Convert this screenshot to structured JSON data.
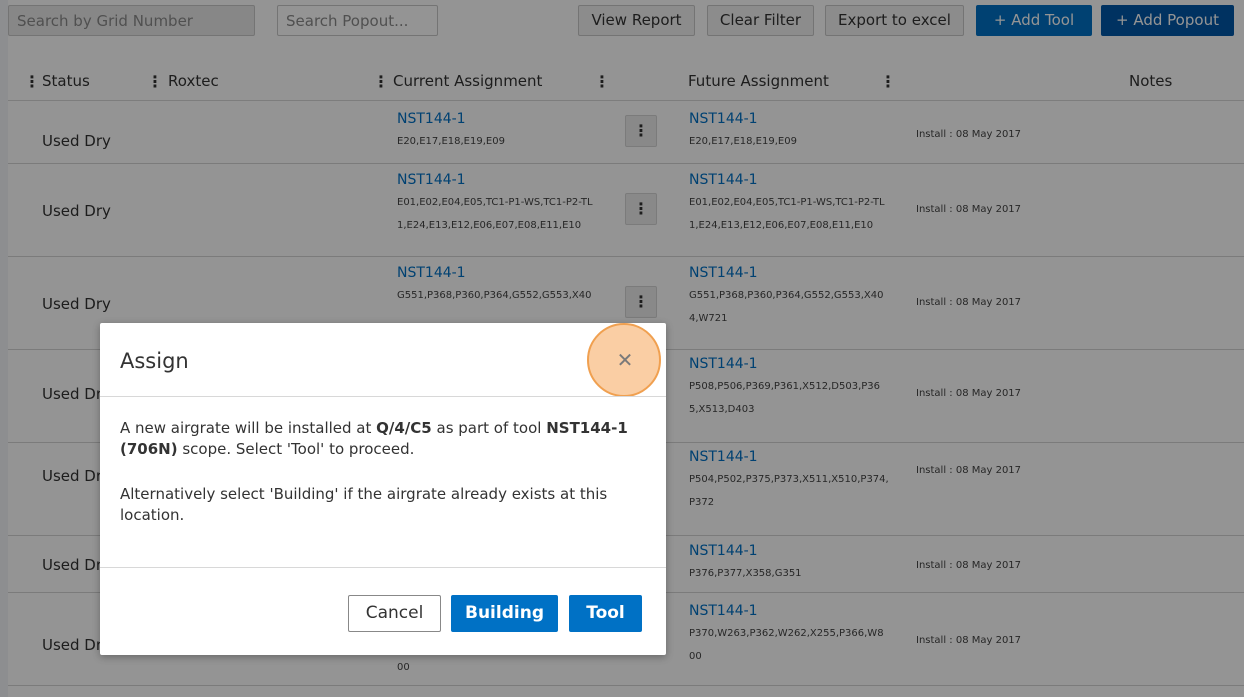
{
  "toolbar": {
    "grid_search_placeholder": "Search by Grid Number",
    "popout_search_placeholder": "Search Popout...",
    "view_report": "View Report",
    "clear_filter": "Clear Filter",
    "export_excel": "Export to excel",
    "add_tool": "+ Add Tool",
    "add_popout": "+ Add Popout"
  },
  "table": {
    "headers": {
      "status": "Status",
      "roxtec": "Roxtec",
      "current": "Current Assignment",
      "future": "Future Assignment",
      "notes": "Notes"
    },
    "rows": [
      {
        "status": "Used Dry",
        "cur_link": "NST144-1",
        "cur_codes": [
          "E20,E17,E18,E19,E09"
        ],
        "fut_link": "NST144-1",
        "fut_codes": [
          "E20,E17,E18,E19,E09"
        ],
        "install": "Install : 08 May 2017"
      },
      {
        "status": "Used Dry",
        "cur_link": "NST144-1",
        "cur_codes": [
          "E01,E02,E04,E05,TC1-P1-WS,TC1-P2-TL",
          "1,E24,E13,E12,E06,E07,E08,E11,E10"
        ],
        "fut_link": "NST144-1",
        "fut_codes": [
          "E01,E02,E04,E05,TC1-P1-WS,TC1-P2-TL",
          "1,E24,E13,E12,E06,E07,E08,E11,E10"
        ],
        "install": "Install : 08 May 2017"
      },
      {
        "status": "Used Dry",
        "cur_link": "NST144-1",
        "cur_codes": [
          "G551,P368,P360,P364,G552,G553,X40"
        ],
        "fut_link": "NST144-1",
        "fut_codes": [
          "G551,P368,P360,P364,G552,G553,X40",
          "4,W721"
        ],
        "install": "Install : 08 May 2017"
      },
      {
        "status": "Used Dr",
        "cur_link": "",
        "cur_codes": [],
        "fut_link": "NST144-1",
        "fut_codes": [
          "P508,P506,P369,P361,X512,D503,P36",
          "5,X513,D403"
        ],
        "install": "Install : 08 May 2017"
      },
      {
        "status": "Used Dr",
        "cur_link": "",
        "cur_codes": [],
        "fut_link": "NST144-1",
        "fut_codes": [
          "P504,P502,P375,P373,X511,X510,P374,",
          "P372"
        ],
        "install": "Install : 08 May 2017"
      },
      {
        "status": "Used Dr",
        "cur_link": "",
        "cur_codes": [],
        "fut_link": "NST144-1",
        "fut_codes": [
          "P376,P377,X358,G351"
        ],
        "install": "Install : 08 May 2017"
      },
      {
        "status": "Used Dr",
        "cur_link": "",
        "cur_codes": [
          "00"
        ],
        "fut_link": "NST144-1",
        "fut_codes": [
          "P370,W263,P362,W262,X255,P366,W8",
          "00"
        ],
        "install": "Install : 08 May 2017"
      }
    ]
  },
  "modal": {
    "title": "Assign",
    "close_icon": "close-icon",
    "p1_pre": "A new airgrate will be installed at ",
    "p1_loc": "Q/4/C5",
    "p1_mid": " as part of tool ",
    "p1_tool": "NST144-1 (706N)",
    "p1_post": " scope. Select 'Tool' to proceed.",
    "p2": "Alternatively select 'Building' if the airgrate already exists at this location.",
    "cancel": "Cancel",
    "building": "Building",
    "tool": "Tool"
  }
}
